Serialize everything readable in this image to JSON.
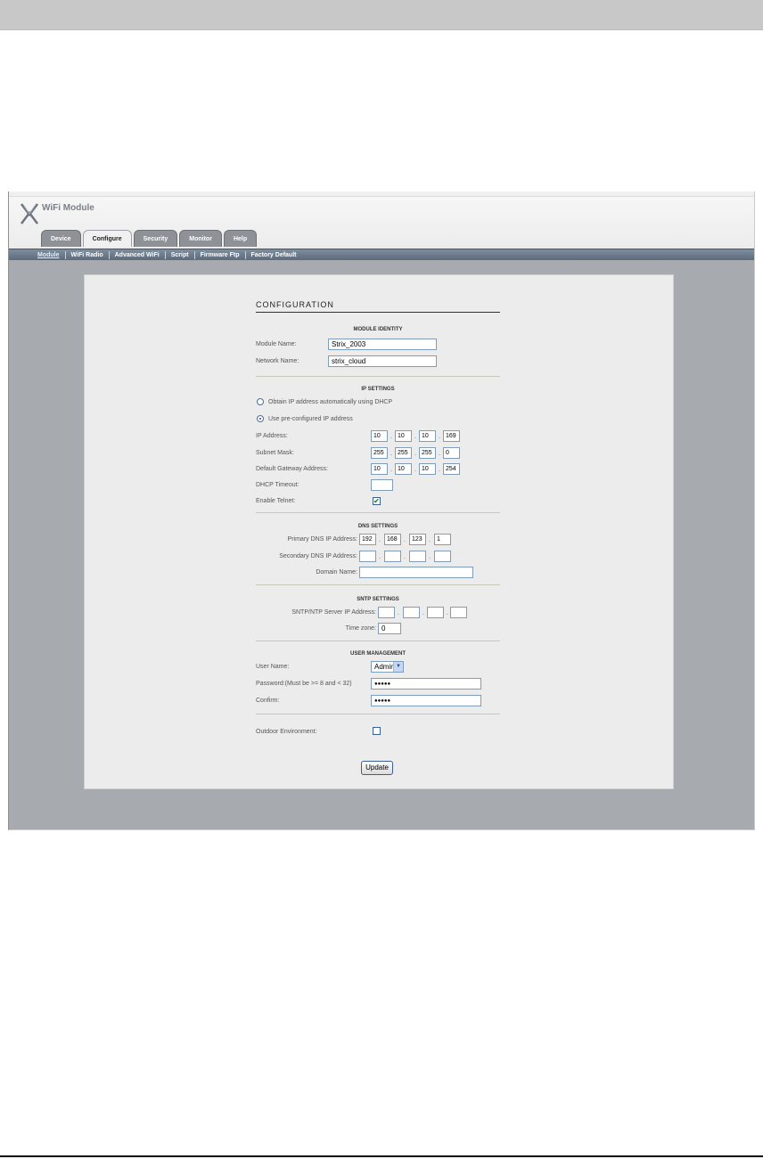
{
  "app": {
    "title": "WiFi Module"
  },
  "tabs": [
    {
      "label": "Device",
      "active": false
    },
    {
      "label": "Configure",
      "active": true
    },
    {
      "label": "Security",
      "active": false
    },
    {
      "label": "Monitor",
      "active": false
    },
    {
      "label": "Help",
      "active": false
    }
  ],
  "subnav": [
    {
      "label": "Module",
      "active": true
    },
    {
      "label": "WiFi Radio",
      "active": false
    },
    {
      "label": "Advanced WiFi",
      "active": false
    },
    {
      "label": "Script",
      "active": false
    },
    {
      "label": "Firmware Ftp",
      "active": false
    },
    {
      "label": "Factory Default",
      "active": false
    }
  ],
  "config": {
    "title": "CONFIGURATION",
    "module_identity": {
      "heading": "MODULE IDENTITY",
      "module_name_label": "Module Name:",
      "module_name_value": "Strix_2003",
      "network_name_label": "Network Name:",
      "network_name_value": "strix_cloud"
    },
    "ip_settings": {
      "heading": "IP SETTINGS",
      "dhcp_label": "Obtain IP address automatically using DHCP",
      "preconfigured_label": "Use pre-configured IP address",
      "ip_label": "IP Address:",
      "ip": [
        "10",
        "10",
        "10",
        "169"
      ],
      "subnet_label": "Subnet Mask:",
      "subnet": [
        "255",
        "255",
        "255",
        "0"
      ],
      "gateway_label": "Default Gateway Address:",
      "gateway": [
        "10",
        "10",
        "10",
        "254"
      ],
      "dhcp_timeout_label": "DHCP Timeout:",
      "dhcp_timeout_value": "",
      "telnet_label": "Enable Telnet:",
      "telnet_checked": "✔"
    },
    "dns_settings": {
      "heading": "DNS SETTINGS",
      "primary_label": "Primary DNS IP Address:",
      "primary": [
        "192",
        "168",
        "123",
        "1"
      ],
      "secondary_label": "Secondary DNS IP Address:",
      "secondary": [
        "",
        "",
        "",
        ""
      ],
      "domain_label": "Domain Name:",
      "domain_value": ""
    },
    "sntp_settings": {
      "heading": "SNTP SETTINGS",
      "server_label": "SNTP/NTP Server IP Address:",
      "server": [
        "",
        "",
        "",
        ""
      ],
      "timezone_label": "Time zone:",
      "timezone_value": "0"
    },
    "user_management": {
      "heading": "USER MANAGEMENT",
      "user_label": "User Name:",
      "user_value": "Admin",
      "password_label": "Password:(Must be >= 8 and < 32)",
      "password_value": "●●●●●",
      "confirm_label": "Confirm:",
      "confirm_value": "●●●●●"
    },
    "outdoor_label": "Outdoor Environment:",
    "update_label": "Update"
  }
}
